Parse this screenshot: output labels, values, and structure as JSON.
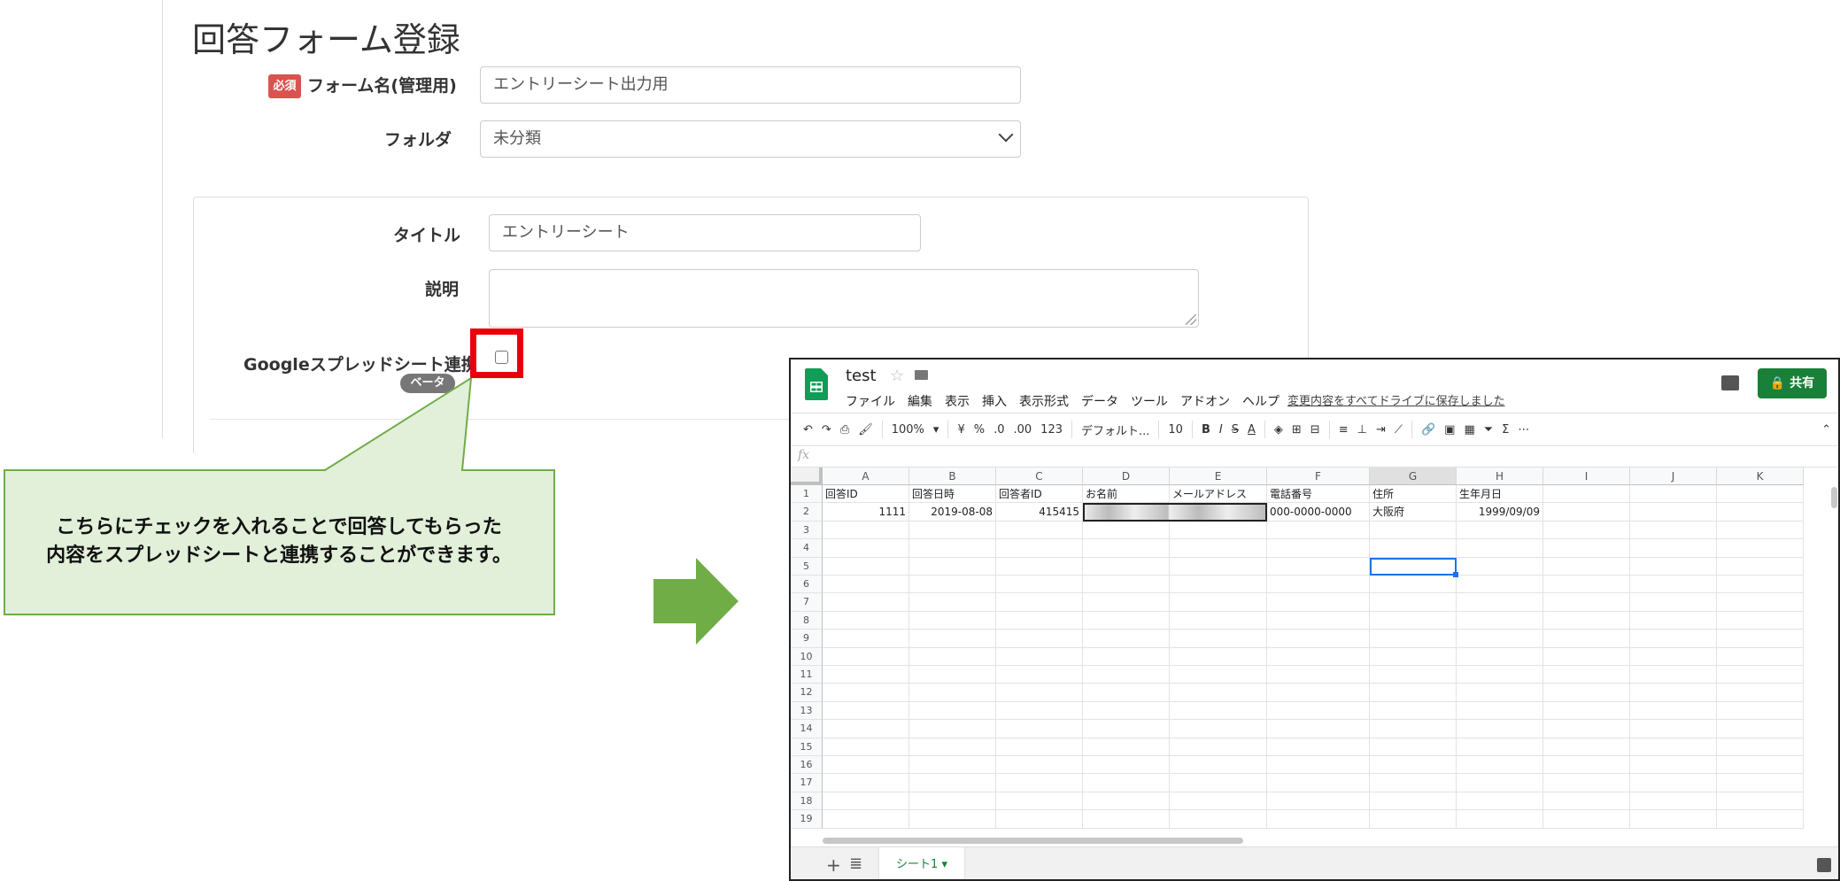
{
  "form": {
    "title": "回答フォーム登録",
    "required_badge": "必須",
    "form_name_label": "フォーム名(管理用)",
    "form_name_value": "エントリーシート出力用",
    "folder_label": "フォルダ",
    "folder_value": "未分類",
    "title_label": "タイトル",
    "title_value": "エントリーシート",
    "description_label": "説明",
    "description_value": "",
    "google_sheet_label": "Googleスプレッドシート連携",
    "beta_badge": "ベータ",
    "google_sheet_checked": false
  },
  "callout": {
    "line1": "こちらにチェックを入れることで回答してもらった",
    "line2": "内容をスプレッドシートと連携することができます。"
  },
  "colors": {
    "highlight": "#e8000b",
    "callout_fill": "#e2efd9",
    "callout_stroke": "#70ad47",
    "arrow": "#70ad47",
    "share_button": "#188038"
  },
  "sheet": {
    "doc_title": "test",
    "menu": [
      "ファイル",
      "編集",
      "表示",
      "挿入",
      "表示形式",
      "データ",
      "ツール",
      "アドオン",
      "ヘルプ"
    ],
    "saved_status": "変更内容をすべてドライブに保存しました",
    "share_label": "共有",
    "toolbar": {
      "zoom": "100%",
      "currency": "¥",
      "percent": "%",
      "dec_less": ".0",
      "dec_more": ".00",
      "format": "123",
      "font": "デフォルト...",
      "font_size": "10",
      "bold": "B",
      "italic": "I",
      "strike": "S",
      "text_color": "A"
    },
    "formula_icon": "fx",
    "columns": [
      "A",
      "B",
      "C",
      "D",
      "E",
      "F",
      "G",
      "H",
      "I",
      "J",
      "K"
    ],
    "rows": [
      [
        "回答ID",
        "回答日時",
        "回答者ID",
        "お名前",
        "メールアドレス",
        "電話番号",
        "住所",
        "生年月日",
        "",
        "",
        ""
      ],
      [
        "1111",
        "2019-08-08",
        "415415",
        "",
        "",
        "000-0000-0000",
        "大阪府",
        "1999/09/09",
        "",
        "",
        ""
      ]
    ],
    "row_count": 19,
    "selected_cell": "G5",
    "tab_label": "シート1",
    "tab_chevron": "▾"
  }
}
